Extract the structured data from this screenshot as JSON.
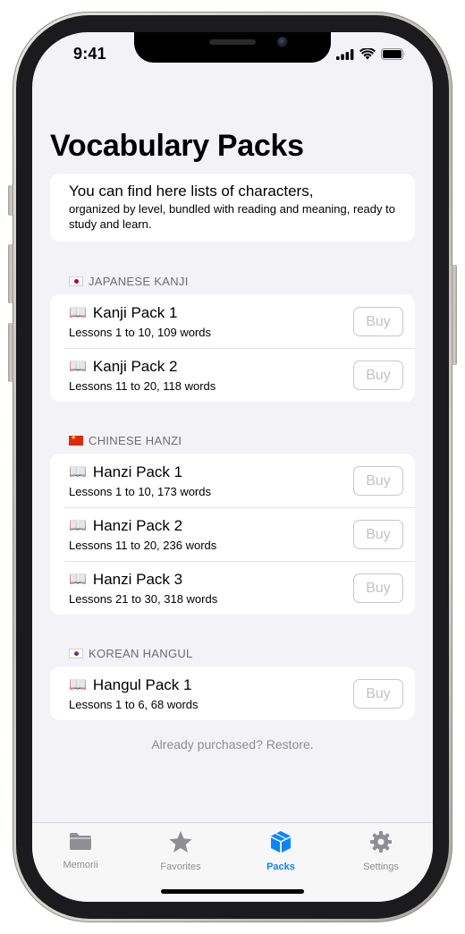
{
  "status_bar": {
    "time": "9:41"
  },
  "header": {
    "title": "Vocabulary Packs"
  },
  "intro": {
    "headline": "You can find here lists of characters,",
    "body": "organized by level, bundled with reading and meaning, ready to study and learn."
  },
  "sections": [
    {
      "flag": "jp-flag",
      "title": "JAPANESE KANJI",
      "items": [
        {
          "title": "Kanji Pack 1",
          "subtitle": "Lessons 1 to 10, 109 words",
          "button": "Buy"
        },
        {
          "title": "Kanji Pack 2",
          "subtitle": "Lessons 11 to 20, 118 words",
          "button": "Buy"
        }
      ]
    },
    {
      "flag": "cn-flag",
      "title": "CHINESE HANZI",
      "items": [
        {
          "title": "Hanzi Pack 1",
          "subtitle": "Lessons 1 to 10, 173 words",
          "button": "Buy"
        },
        {
          "title": "Hanzi Pack 2",
          "subtitle": "Lessons 11 to 20, 236 words",
          "button": "Buy"
        },
        {
          "title": "Hanzi Pack 3",
          "subtitle": "Lessons 21 to 30, 318 words",
          "button": "Buy"
        }
      ]
    },
    {
      "flag": "kr-flag",
      "title": "KOREAN HANGUL",
      "items": [
        {
          "title": "Hangul Pack 1",
          "subtitle": "Lessons 1 to 6, 68 words",
          "button": "Buy"
        }
      ]
    }
  ],
  "restore": "Already purchased? Restore.",
  "tabbar": {
    "tabs": [
      {
        "label": "Memorii",
        "icon": "folder-icon",
        "active": false
      },
      {
        "label": "Favorites",
        "icon": "star-icon",
        "active": false
      },
      {
        "label": "Packs",
        "icon": "box-icon",
        "active": true
      },
      {
        "label": "Settings",
        "icon": "gear-icon",
        "active": false
      }
    ]
  },
  "colors": {
    "accent": "#0a84ff",
    "background": "#f2f2f7",
    "inactive_tab": "#8e8e93",
    "disabled_button": "#c2c2c7"
  }
}
